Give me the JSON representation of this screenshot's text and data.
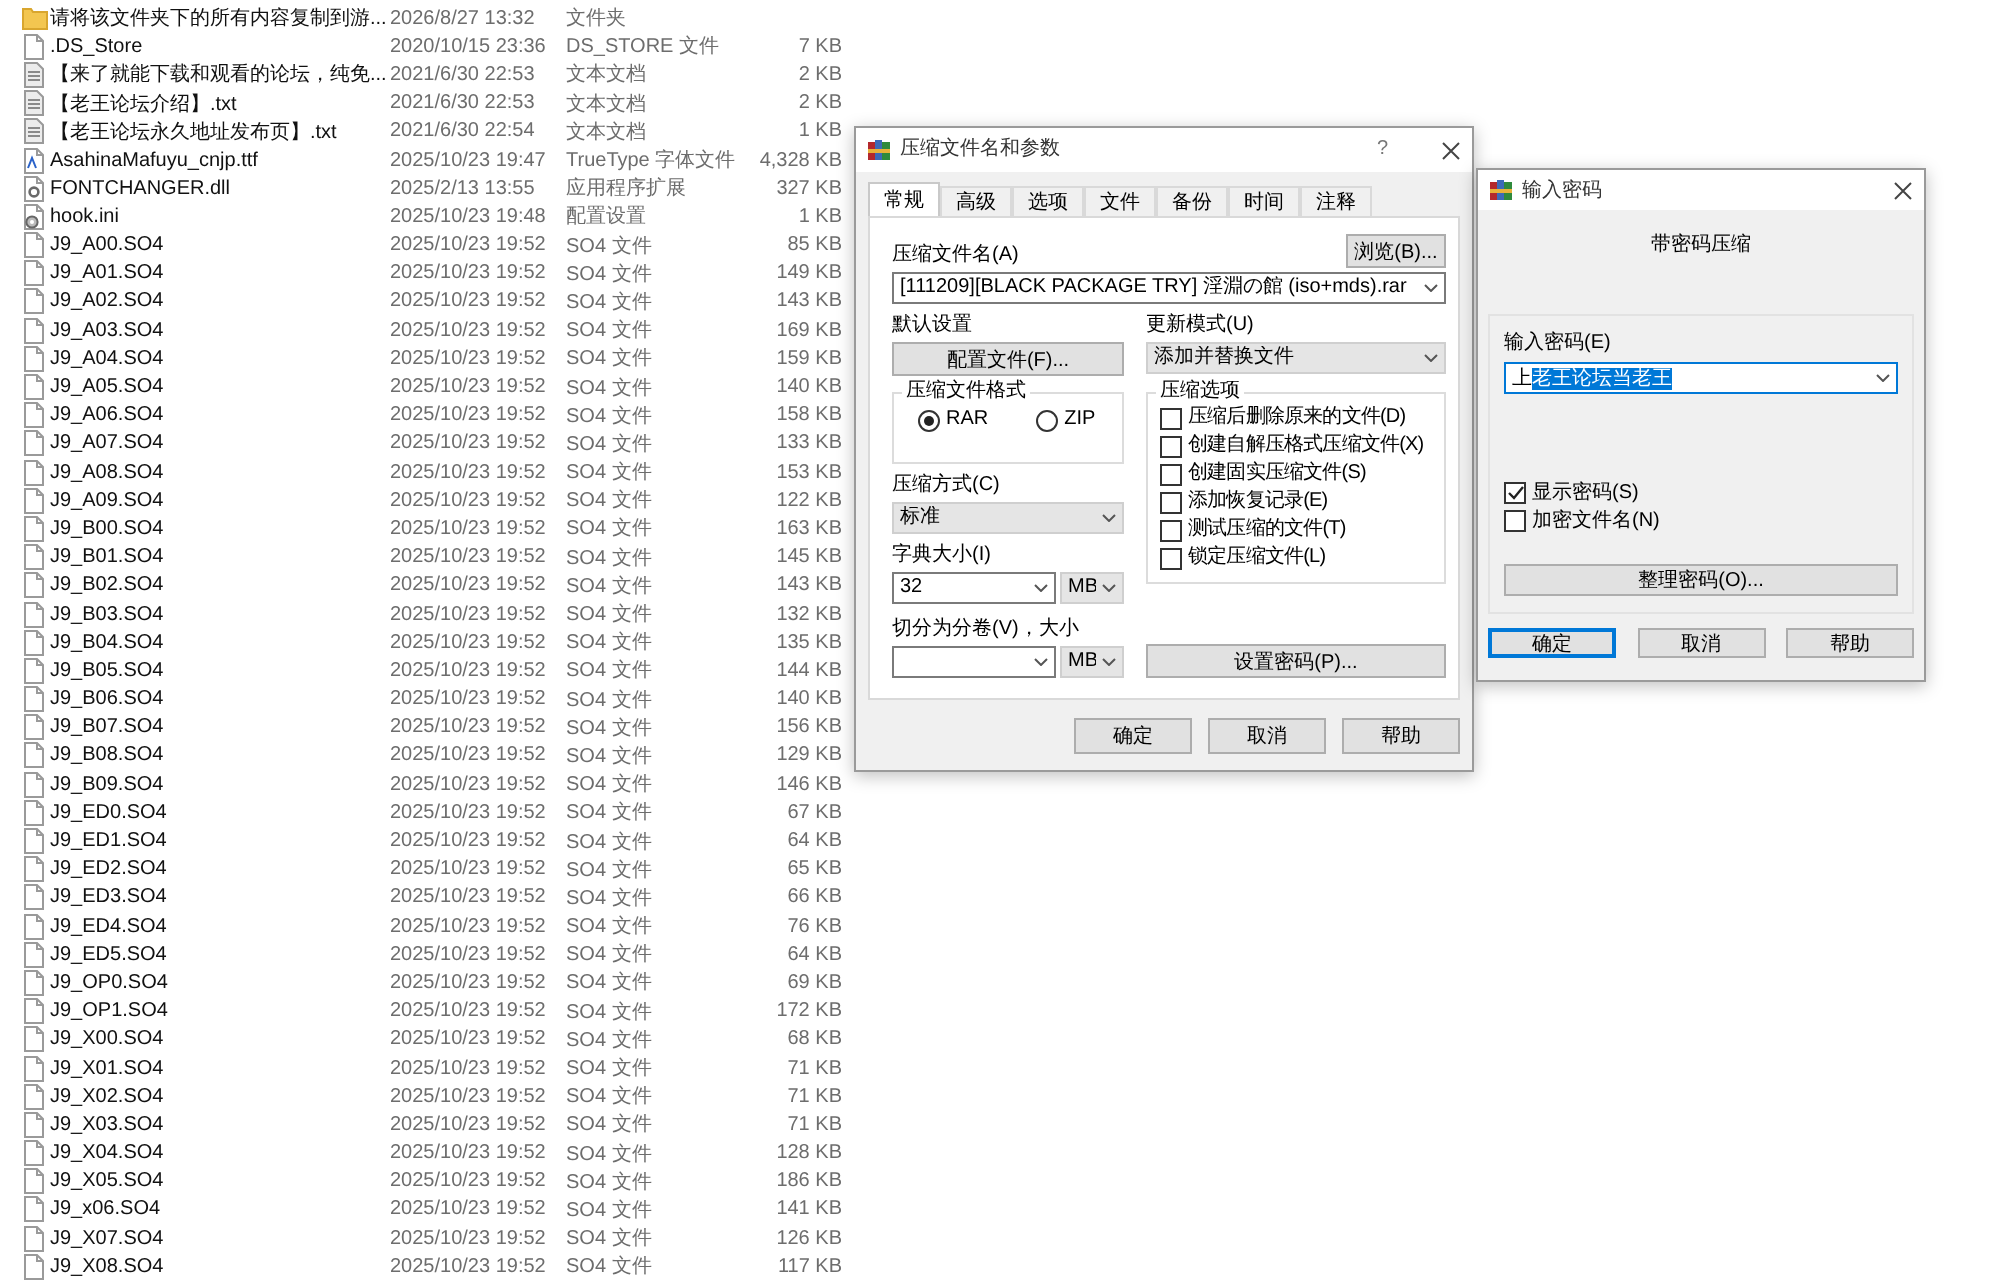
{
  "file_list": {
    "rows": [
      {
        "kind": "folder",
        "name": "请将该文件夹下的所有内容复制到游...",
        "modified": "2026/8/27 13:32",
        "type": "文件夹"
      },
      {
        "kind": "file",
        "name": ".DS_Store",
        "modified": "2020/10/15 23:36",
        "type": "DS_STORE 文件",
        "size": "7 KB"
      },
      {
        "kind": "text",
        "name": "【来了就能下载和观看的论坛，纯免...",
        "modified": "2021/6/30 22:53",
        "type": "文本文档",
        "size": "2 KB"
      },
      {
        "kind": "text",
        "name": "【老王论坛介绍】.txt",
        "modified": "2021/6/30 22:53",
        "type": "文本文档",
        "size": "2 KB"
      },
      {
        "kind": "text",
        "name": "【老王论坛永久地址发布页】.txt",
        "modified": "2021/6/30 22:54",
        "type": "文本文档",
        "size": "1 KB"
      },
      {
        "kind": "font",
        "name": "AsahinaMafuyu_cnjp.ttf",
        "modified": "2025/10/23 19:47",
        "type": "TrueType 字体文件",
        "size": "4,328 KB"
      },
      {
        "kind": "dll",
        "name": "FONTCHANGER.dll",
        "modified": "2025/2/13 13:55",
        "type": "应用程序扩展",
        "size": "327 KB"
      },
      {
        "kind": "config",
        "name": "hook.ini",
        "modified": "2025/10/23 19:48",
        "type": "配置设置",
        "size": "1 KB"
      },
      {
        "kind": "file",
        "name": "J9_A00.SO4",
        "modified": "2025/10/23 19:52",
        "type": "SO4 文件",
        "size": "85 KB"
      },
      {
        "kind": "file",
        "name": "J9_A01.SO4",
        "modified": "2025/10/23 19:52",
        "type": "SO4 文件",
        "size": "149 KB"
      },
      {
        "kind": "file",
        "name": "J9_A02.SO4",
        "modified": "2025/10/23 19:52",
        "type": "SO4 文件",
        "size": "143 KB"
      },
      {
        "kind": "file",
        "name": "J9_A03.SO4",
        "modified": "2025/10/23 19:52",
        "type": "SO4 文件",
        "size": "169 KB"
      },
      {
        "kind": "file",
        "name": "J9_A04.SO4",
        "modified": "2025/10/23 19:52",
        "type": "SO4 文件",
        "size": "159 KB"
      },
      {
        "kind": "file",
        "name": "J9_A05.SO4",
        "modified": "2025/10/23 19:52",
        "type": "SO4 文件",
        "size": "140 KB"
      },
      {
        "kind": "file",
        "name": "J9_A06.SO4",
        "modified": "2025/10/23 19:52",
        "type": "SO4 文件",
        "size": "158 KB"
      },
      {
        "kind": "file",
        "name": "J9_A07.SO4",
        "modified": "2025/10/23 19:52",
        "type": "SO4 文件",
        "size": "133 KB"
      },
      {
        "kind": "file",
        "name": "J9_A08.SO4",
        "modified": "2025/10/23 19:52",
        "type": "SO4 文件",
        "size": "153 KB"
      },
      {
        "kind": "file",
        "name": "J9_A09.SO4",
        "modified": "2025/10/23 19:52",
        "type": "SO4 文件",
        "size": "122 KB"
      },
      {
        "kind": "file",
        "name": "J9_B00.SO4",
        "modified": "2025/10/23 19:52",
        "type": "SO4 文件",
        "size": "163 KB"
      },
      {
        "kind": "file",
        "name": "J9_B01.SO4",
        "modified": "2025/10/23 19:52",
        "type": "SO4 文件",
        "size": "145 KB"
      },
      {
        "kind": "file",
        "name": "J9_B02.SO4",
        "modified": "2025/10/23 19:52",
        "type": "SO4 文件",
        "size": "143 KB"
      },
      {
        "kind": "file",
        "name": "J9_B03.SO4",
        "modified": "2025/10/23 19:52",
        "type": "SO4 文件",
        "size": "132 KB"
      },
      {
        "kind": "file",
        "name": "J9_B04.SO4",
        "modified": "2025/10/23 19:52",
        "type": "SO4 文件",
        "size": "135 KB"
      },
      {
        "kind": "file",
        "name": "J9_B05.SO4",
        "modified": "2025/10/23 19:52",
        "type": "SO4 文件",
        "size": "144 KB"
      },
      {
        "kind": "file",
        "name": "J9_B06.SO4",
        "modified": "2025/10/23 19:52",
        "type": "SO4 文件",
        "size": "140 KB"
      },
      {
        "kind": "file",
        "name": "J9_B07.SO4",
        "modified": "2025/10/23 19:52",
        "type": "SO4 文件",
        "size": "156 KB"
      },
      {
        "kind": "file",
        "name": "J9_B08.SO4",
        "modified": "2025/10/23 19:52",
        "type": "SO4 文件",
        "size": "129 KB"
      },
      {
        "kind": "file",
        "name": "J9_B09.SO4",
        "modified": "2025/10/23 19:52",
        "type": "SO4 文件",
        "size": "146 KB"
      },
      {
        "kind": "file",
        "name": "J9_ED0.SO4",
        "modified": "2025/10/23 19:52",
        "type": "SO4 文件",
        "size": "67 KB"
      },
      {
        "kind": "file",
        "name": "J9_ED1.SO4",
        "modified": "2025/10/23 19:52",
        "type": "SO4 文件",
        "size": "64 KB"
      },
      {
        "kind": "file",
        "name": "J9_ED2.SO4",
        "modified": "2025/10/23 19:52",
        "type": "SO4 文件",
        "size": "65 KB"
      },
      {
        "kind": "file",
        "name": "J9_ED3.SO4",
        "modified": "2025/10/23 19:52",
        "type": "SO4 文件",
        "size": "66 KB"
      },
      {
        "kind": "file",
        "name": "J9_ED4.SO4",
        "modified": "2025/10/23 19:52",
        "type": "SO4 文件",
        "size": "76 KB"
      },
      {
        "kind": "file",
        "name": "J9_ED5.SO4",
        "modified": "2025/10/23 19:52",
        "type": "SO4 文件",
        "size": "64 KB"
      },
      {
        "kind": "file",
        "name": "J9_OP0.SO4",
        "modified": "2025/10/23 19:52",
        "type": "SO4 文件",
        "size": "69 KB"
      },
      {
        "kind": "file",
        "name": "J9_OP1.SO4",
        "modified": "2025/10/23 19:52",
        "type": "SO4 文件",
        "size": "172 KB"
      },
      {
        "kind": "file",
        "name": "J9_X00.SO4",
        "modified": "2025/10/23 19:52",
        "type": "SO4 文件",
        "size": "68 KB"
      },
      {
        "kind": "file",
        "name": "J9_X01.SO4",
        "modified": "2025/10/23 19:52",
        "type": "SO4 文件",
        "size": "71 KB"
      },
      {
        "kind": "file",
        "name": "J9_X02.SO4",
        "modified": "2025/10/23 19:52",
        "type": "SO4 文件",
        "size": "71 KB"
      },
      {
        "kind": "file",
        "name": "J9_X03.SO4",
        "modified": "2025/10/23 19:52",
        "type": "SO4 文件",
        "size": "71 KB"
      },
      {
        "kind": "file",
        "name": "J9_X04.SO4",
        "modified": "2025/10/23 19:52",
        "type": "SO4 文件",
        "size": "128 KB"
      },
      {
        "kind": "file",
        "name": "J9_X05.SO4",
        "modified": "2025/10/23 19:52",
        "type": "SO4 文件",
        "size": "186 KB"
      },
      {
        "kind": "file",
        "name": "J9_x06.SO4",
        "modified": "2025/10/23 19:52",
        "type": "SO4 文件",
        "size": "141 KB"
      },
      {
        "kind": "file",
        "name": "J9_X07.SO4",
        "modified": "2025/10/23 19:52",
        "type": "SO4 文件",
        "size": "126 KB"
      },
      {
        "kind": "file",
        "name": "J9_X08.SO4",
        "modified": "2025/10/23 19:52",
        "type": "SO4 文件",
        "size": "117 KB"
      }
    ]
  },
  "archive_dialog": {
    "title": "压缩文件名和参数",
    "help_button": "?",
    "tabs": [
      {
        "label": "常规",
        "selected": true
      },
      {
        "label": "高级",
        "selected": false
      },
      {
        "label": "选项",
        "selected": false
      },
      {
        "label": "文件",
        "selected": false
      },
      {
        "label": "备份",
        "selected": false
      },
      {
        "label": "时间",
        "selected": false
      },
      {
        "label": "注释",
        "selected": false
      }
    ],
    "archive_name_label": "压缩文件名(A)",
    "browse_button": "浏览(B)...",
    "archive_name": "[111209][BLACK PACKAGE TRY] 淫淵の館 (iso+mds).rar",
    "profile_label": "默认设置",
    "profile_button": "配置文件(F)...",
    "update_mode_label": "更新模式(U)",
    "update_mode": "添加并替换文件",
    "format_group": {
      "title": "压缩文件格式",
      "options": [
        {
          "label": "RAR",
          "selected": true
        },
        {
          "label": "ZIP",
          "selected": false
        }
      ]
    },
    "method_label": "压缩方式(C)",
    "method": "标准",
    "dict_label": "字典大小(I)",
    "dict_size": "32",
    "dict_unit": "MB",
    "split_label": "切分为分卷(V)，大小",
    "split_unit": "MB",
    "options_group": {
      "title": "压缩选项",
      "items": [
        {
          "label": "压缩后删除原来的文件(D)",
          "checked": false
        },
        {
          "label": "创建自解压格式压缩文件(X)",
          "checked": false
        },
        {
          "label": "创建固实压缩文件(S)",
          "checked": false
        },
        {
          "label": "添加恢复记录(E)",
          "checked": false
        },
        {
          "label": "测试压缩的文件(T)",
          "checked": false
        },
        {
          "label": "锁定压缩文件(L)",
          "checked": false
        }
      ]
    },
    "password_button": "设置密码(P)...",
    "buttons": [
      {
        "label": "确定",
        "focused": false
      },
      {
        "label": "取消",
        "focused": false
      },
      {
        "label": "帮助",
        "focused": false
      }
    ]
  },
  "password_dialog": {
    "title": "输入密码",
    "heading": "带密码压缩",
    "password_label": "输入密码(E)",
    "password_unselected": "上",
    "password_selected": "老王论坛当老王",
    "options": [
      {
        "label": "显示密码(S)",
        "checked": true
      },
      {
        "label": "加密文件名(N)",
        "checked": false
      }
    ],
    "organize_button": "整理密码(O)...",
    "buttons": [
      {
        "label": "确定",
        "focused": true
      },
      {
        "label": "取消",
        "focused": false
      },
      {
        "label": "帮助",
        "focused": false
      }
    ]
  }
}
